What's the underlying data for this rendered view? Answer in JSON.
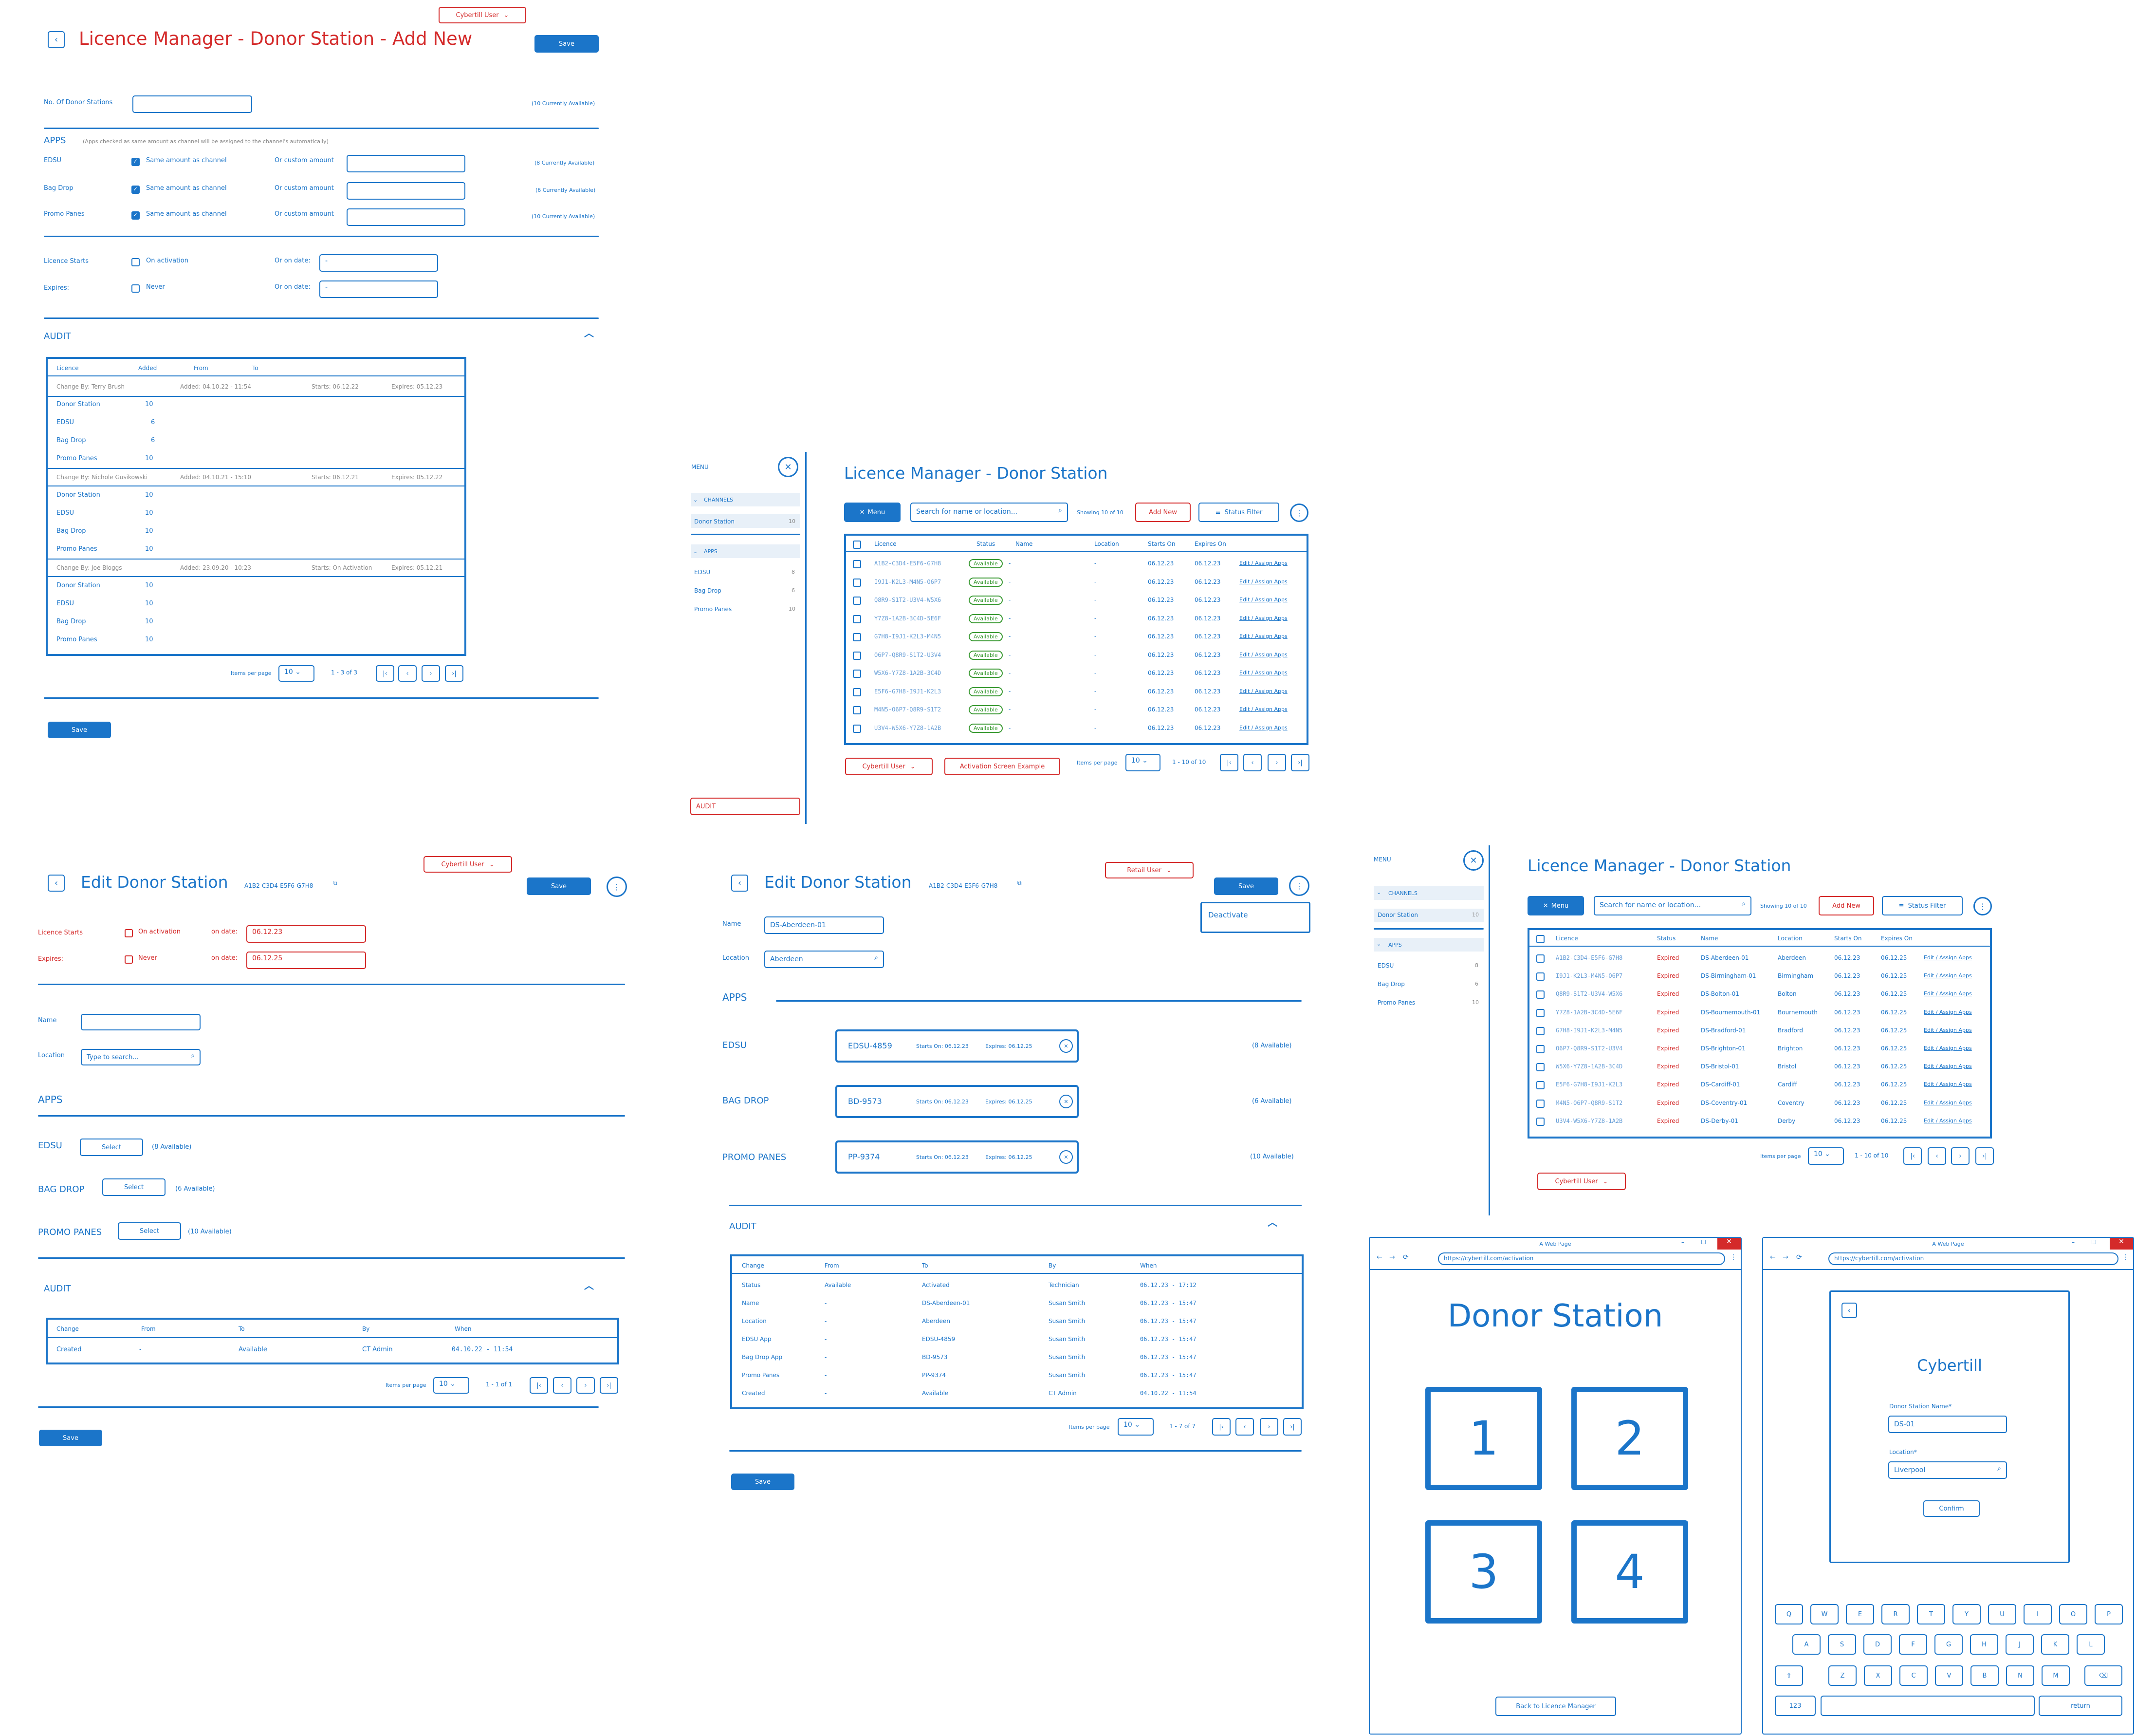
{
  "user_label": "Cybertill User",
  "retail_user_label": "Retail User",
  "save": "Save",
  "select": "Select",
  "items_per_page": "Items per page",
  "per_page_value": "10",
  "s1": {
    "title": "Licence Manager - Donor Station - Add New",
    "num_label": "No. Of Donor Stations",
    "num_avail": "(10 Currently Available)",
    "apps": "APPS",
    "apps_note": "(Apps checked as same amount as channel will be assigned to the channel's automatically)",
    "same": "Same amount as channel",
    "custom": "Or custom amount",
    "rows": [
      {
        "name": "EDSU",
        "avail": "(8 Currently Available)"
      },
      {
        "name": "Bag Drop",
        "avail": "(6 Currently Available)"
      },
      {
        "name": "Promo Panes",
        "avail": "(10 Currently Available)"
      }
    ],
    "starts": "Licence Starts",
    "on_activation": "On activation",
    "or_on_date": "Or on date:",
    "expires": "Expires:",
    "never": "Never",
    "date_ph": "-",
    "audit": "AUDIT",
    "cols": [
      "Licence",
      "Added",
      "From",
      "To"
    ],
    "groups": [
      {
        "by": "Change By: Terry Brush",
        "added": "Added: 04.10.22 - 11:54",
        "starts": "Starts: 06.12.22",
        "expires": "Expires: 05.12.23",
        "rows": [
          [
            "Donor Station",
            "10"
          ],
          [
            "EDSU",
            "6"
          ],
          [
            "Bag Drop",
            "6"
          ],
          [
            "Promo Panes",
            "10"
          ]
        ]
      },
      {
        "by": "Change By: Nichole Gusikowski",
        "added": "Added: 04.10.21 - 15:10",
        "starts": "Starts: 06.12.21",
        "expires": "Expires: 05.12.22",
        "rows": [
          [
            "Donor Station",
            "10"
          ],
          [
            "EDSU",
            "10"
          ],
          [
            "Bag Drop",
            "10"
          ],
          [
            "Promo Panes",
            "10"
          ]
        ]
      },
      {
        "by": "Change By: Joe Bloggs",
        "added": "Added: 23.09.20 - 10:23",
        "starts": "Starts: On Activation",
        "expires": "Expires: 05.12.21",
        "rows": [
          [
            "Donor Station",
            "10"
          ],
          [
            "EDSU",
            "10"
          ],
          [
            "Bag Drop",
            "10"
          ],
          [
            "Promo Panes",
            "10"
          ]
        ]
      }
    ],
    "pager": "1 - 3 of 3"
  },
  "s2": {
    "menu": "MENU",
    "channels": "CHANNELS",
    "donor_station": "Donor Station",
    "ds_count": "10",
    "apps": "APPS",
    "apps_items": [
      [
        "EDSU",
        "8"
      ],
      [
        "Bag Drop",
        "6"
      ],
      [
        "Promo Panes",
        "10"
      ]
    ],
    "audit": "AUDIT",
    "title": "Licence Manager - Donor Station",
    "menu_btn": "Menu",
    "search_ph": "Search for name or location...",
    "showing": "Showing 10 of 10",
    "add_new": "Add New",
    "status_filter": "Status Filter",
    "cols": [
      "Licence",
      "Status",
      "Name",
      "Location",
      "Starts On",
      "Expires On"
    ],
    "rows": [
      [
        "A1B2-C3D4-E5F6-G7H8",
        "Available",
        "-",
        "-",
        "06.12.23",
        "06.12.23",
        "Edit / Assign Apps"
      ],
      [
        "I9J1-K2L3-M4N5-O6P7",
        "Available",
        "-",
        "-",
        "06.12.23",
        "06.12.23",
        "Edit / Assign Apps"
      ],
      [
        "Q8R9-S1T2-U3V4-W5X6",
        "Available",
        "-",
        "-",
        "06.12.23",
        "06.12.23",
        "Edit / Assign Apps"
      ],
      [
        "Y7Z8-1A2B-3C4D-5E6F",
        "Available",
        "-",
        "-",
        "06.12.23",
        "06.12.23",
        "Edit / Assign Apps"
      ],
      [
        "G7H8-I9J1-K2L3-M4N5",
        "Available",
        "-",
        "-",
        "06.12.23",
        "06.12.23",
        "Edit / Assign Apps"
      ],
      [
        "O6P7-Q8R9-S1T2-U3V4",
        "Available",
        "-",
        "-",
        "06.12.23",
        "06.12.23",
        "Edit / Assign Apps"
      ],
      [
        "W5X6-Y7Z8-1A2B-3C4D",
        "Available",
        "-",
        "-",
        "06.12.23",
        "06.12.23",
        "Edit / Assign Apps"
      ],
      [
        "E5F6-G7H8-I9J1-K2L3",
        "Available",
        "-",
        "-",
        "06.12.23",
        "06.12.23",
        "Edit / Assign Apps"
      ],
      [
        "M4N5-O6P7-Q8R9-S1T2",
        "Available",
        "-",
        "-",
        "06.12.23",
        "06.12.23",
        "Edit / Assign Apps"
      ],
      [
        "U3V4-W5X6-Y7Z8-1A2B",
        "Available",
        "-",
        "-",
        "06.12.23",
        "06.12.23",
        "Edit / Assign Apps"
      ]
    ],
    "activation_btn": "Activation Screen Example",
    "pager": "1 - 10 of 10"
  },
  "s3": {
    "title": "Edit Donor Station",
    "id": "A1B2-C3D4-E5F6-G7H8",
    "starts": "Licence Starts",
    "on_activation": "On activation",
    "on_date": "on date:",
    "start_date": "06.12.23",
    "expires": "Expires:",
    "never": "Never",
    "exp_date": "06.12.25",
    "name": "Name",
    "location": "Location",
    "loc_ph": "Type to search...",
    "apps": "APPS",
    "app_rows": [
      [
        "EDSU",
        "(8 Available)"
      ],
      [
        "BAG DROP",
        "(6 Available)"
      ],
      [
        "PROMO PANES",
        "(10 Available)"
      ]
    ],
    "audit": "AUDIT",
    "cols": [
      "Change",
      "From",
      "To",
      "By",
      "When"
    ],
    "row": [
      "Created",
      "-",
      "Available",
      "CT Admin",
      "04.10.22 - 11:54"
    ],
    "pager": "1 - 1 of 1"
  },
  "s4": {
    "title": "Edit Donor Station",
    "id": "A1B2-C3D4-E5F6-G7H8",
    "deactivate": "Deactivate",
    "name": "Name",
    "name_val": "DS-Aberdeen-01",
    "location": "Location",
    "loc_val": "Aberdeen",
    "apps": "APPS",
    "app_rows": [
      {
        "label": "EDSU",
        "code": "EDSU-4859",
        "starts": "Starts On: 06.12.23",
        "expires": "Expires: 06.12.25",
        "avail": "(8 Available)"
      },
      {
        "label": "BAG DROP",
        "code": "BD-9573",
        "starts": "Starts On: 06.12.23",
        "expires": "Expires: 06.12.25",
        "avail": "(6 Available)"
      },
      {
        "label": "PROMO PANES",
        "code": "PP-9374",
        "starts": "Starts On: 06.12.23",
        "expires": "Expires: 06.12.25",
        "avail": "(10 Available)"
      }
    ],
    "audit": "AUDIT",
    "cols": [
      "Change",
      "From",
      "To",
      "By",
      "When"
    ],
    "rows": [
      [
        "Status",
        "Available",
        "Activated",
        "Technician",
        "06.12.23 - 17:12"
      ],
      [
        "Name",
        "-",
        "DS-Aberdeen-01",
        "Susan Smith",
        "06.12.23 - 15:47"
      ],
      [
        "Location",
        "-",
        "Aberdeen",
        "Susan Smith",
        "06.12.23 - 15:47"
      ],
      [
        "EDSU App",
        "-",
        "EDSU-4859",
        "Susan Smith",
        "06.12.23 - 15:47"
      ],
      [
        "Bag Drop App",
        "-",
        "BD-9573",
        "Susan Smith",
        "06.12.23 - 15:47"
      ],
      [
        "Promo Panes",
        "-",
        "PP-9374",
        "Susan Smith",
        "06.12.23 - 15:47"
      ],
      [
        "Created",
        "-",
        "Available",
        "CT Admin",
        "04.10.22 - 11:54"
      ]
    ],
    "pager": "1 - 7 of 7"
  },
  "s5": {
    "menu": "MENU",
    "channels": "CHANNELS",
    "donor_station": "Donor Station",
    "ds_count": "10",
    "apps": "APPS",
    "apps_items": [
      [
        "EDSU",
        "8"
      ],
      [
        "Bag Drop",
        "6"
      ],
      [
        "Promo Panes",
        "10"
      ]
    ],
    "title": "Licence Manager - Donor Station",
    "menu_btn": "Menu",
    "search_ph": "Search for name or location...",
    "showing": "Showing 10 of 10",
    "add_new": "Add New",
    "status_filter": "Status Filter",
    "cols": [
      "Licence",
      "Status",
      "Name",
      "Location",
      "Starts On",
      "Expires On"
    ],
    "rows": [
      [
        "A1B2-C3D4-E5F6-G7H8",
        "Expired",
        "DS-Aberdeen-01",
        "Aberdeen",
        "06.12.23",
        "06.12.25",
        "Edit / Assign Apps"
      ],
      [
        "I9J1-K2L3-M4N5-O6P7",
        "Expired",
        "DS-Birmingham-01",
        "Birmingham",
        "06.12.23",
        "06.12.25",
        "Edit / Assign Apps"
      ],
      [
        "Q8R9-S1T2-U3V4-W5X6",
        "Expired",
        "DS-Bolton-01",
        "Bolton",
        "06.12.23",
        "06.12.25",
        "Edit / Assign Apps"
      ],
      [
        "Y7Z8-1A2B-3C4D-5E6F",
        "Expired",
        "DS-Bournemouth-01",
        "Bournemouth",
        "06.12.23",
        "06.12.25",
        "Edit / Assign Apps"
      ],
      [
        "G7H8-I9J1-K2L3-M4N5",
        "Expired",
        "DS-Bradford-01",
        "Bradford",
        "06.12.23",
        "06.12.25",
        "Edit / Assign Apps"
      ],
      [
        "O6P7-Q8R9-S1T2-U3V4",
        "Expired",
        "DS-Brighton-01",
        "Brighton",
        "06.12.23",
        "06.12.25",
        "Edit / Assign Apps"
      ],
      [
        "W5X6-Y7Z8-1A2B-3C4D",
        "Expired",
        "DS-Bristol-01",
        "Bristol",
        "06.12.23",
        "06.12.25",
        "Edit / Assign Apps"
      ],
      [
        "E5F6-G7H8-I9J1-K2L3",
        "Expired",
        "DS-Cardiff-01",
        "Cardiff",
        "06.12.23",
        "06.12.25",
        "Edit / Assign Apps"
      ],
      [
        "M4N5-O6P7-Q8R9-S1T2",
        "Expired",
        "DS-Coventry-01",
        "Coventry",
        "06.12.23",
        "06.12.25",
        "Edit / Assign Apps"
      ],
      [
        "U3V4-W5X6-Y7Z8-1A2B",
        "Expired",
        "DS-Derby-01",
        "Derby",
        "06.12.23",
        "06.12.25",
        "Edit / Assign Apps"
      ]
    ],
    "pager": "1 - 10 of 10"
  },
  "s6": {
    "window_title": "A Web Page",
    "url": "https://cybertill.com/activation",
    "heading": "Donor Station",
    "tiles": [
      "1",
      "2",
      "3",
      "4"
    ],
    "back": "Back to Licence Manager"
  },
  "s7": {
    "window_title": "A Web Page",
    "url": "https://cybertill.com/activation",
    "heading": "Cybertill",
    "name_label": "Donor Station Name*",
    "name_val": "DS-01",
    "loc_label": "Location*",
    "loc_val": "Liverpool",
    "confirm": "Confirm",
    "keys_row1": [
      "Q",
      "W",
      "E",
      "R",
      "T",
      "Y",
      "U",
      "I",
      "O",
      "P"
    ],
    "keys_row2": [
      "A",
      "S",
      "D",
      "F",
      "G",
      "H",
      "J",
      "K",
      "L"
    ],
    "keys_row3": [
      "Z",
      "X",
      "C",
      "V",
      "B",
      "N",
      "M"
    ],
    "num_key": "123",
    "return_key": "return"
  }
}
